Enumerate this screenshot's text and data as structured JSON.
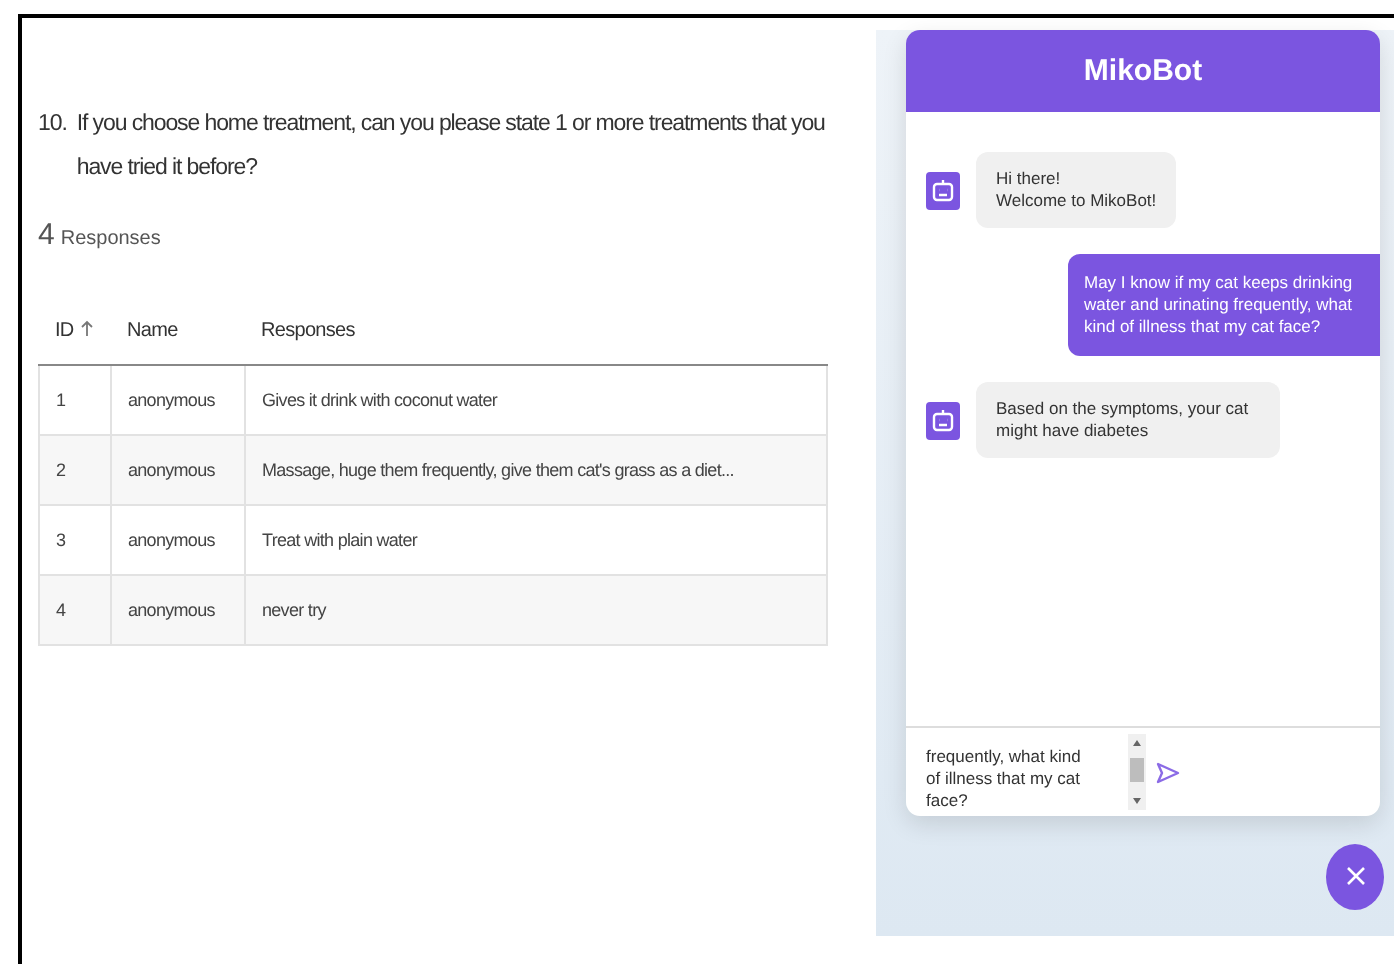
{
  "question": {
    "number": "10.",
    "text": "If you choose home treatment, can you please state 1 or more treatments that you have tried it before?"
  },
  "response_count": {
    "count": "4",
    "label": "Responses"
  },
  "table": {
    "columns": [
      {
        "label": "ID",
        "sorted": true
      },
      {
        "label": "Name",
        "sorted": false
      },
      {
        "label": "Responses",
        "sorted": false
      }
    ],
    "rows": [
      [
        "1",
        "anonymous",
        "Gives it drink with coconut water"
      ],
      [
        "2",
        "anonymous",
        "Massage, huge them frequently, give them cat's grass as a diet..."
      ],
      [
        "3",
        "anonymous",
        "Treat with plain water"
      ],
      [
        "4",
        "anonymous",
        "never try"
      ]
    ]
  },
  "chatbot": {
    "title": "MikoBot",
    "messages": [
      {
        "kind": "bot",
        "lines": [
          "Hi there!",
          "Welcome to MikoBot!"
        ]
      },
      {
        "kind": "user",
        "lines": [
          "May I know if my cat keeps drinking water and urinating frequently, what kind of illness that my cat face?"
        ]
      },
      {
        "kind": "bot",
        "lines": [
          "Based on the symptoms, your cat might have diabetes"
        ]
      }
    ],
    "input_value": "frequently, what kind of illness that my cat face?"
  }
}
